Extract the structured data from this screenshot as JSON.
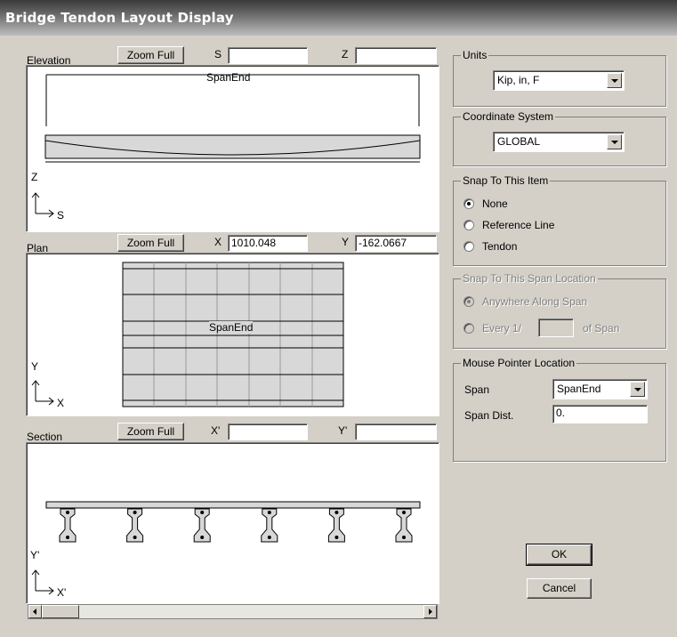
{
  "window": {
    "title": "Bridge Tendon Layout Display"
  },
  "elevation": {
    "label": "Elevation",
    "zoom_label": "Zoom Full",
    "coord1_label": "S",
    "coord1_value": "",
    "coord2_label": "Z",
    "coord2_value": "",
    "span_label": "SpanEnd",
    "axis_v": "Z",
    "axis_h": "S"
  },
  "plan": {
    "label": "Plan",
    "zoom_label": "Zoom Full",
    "coord1_label": "X",
    "coord1_value": "1010.048",
    "coord2_label": "Y",
    "coord2_value": "-162.0667",
    "span_label": "SpanEnd",
    "axis_v": "Y",
    "axis_h": "X"
  },
  "section": {
    "label": "Section",
    "zoom_label": "Zoom Full",
    "coord1_label": "X'",
    "coord1_value": "",
    "coord2_label": "Y'",
    "coord2_value": "",
    "axis_v": "Y'",
    "axis_h": "X'",
    "girder_count": 6
  },
  "units": {
    "title": "Units",
    "selected": "Kip, in, F"
  },
  "coord_system": {
    "title": "Coordinate System",
    "selected": "GLOBAL"
  },
  "snap_item": {
    "title": "Snap To This Item",
    "options": [
      "None",
      "Reference Line",
      "Tendon"
    ],
    "selected": "None"
  },
  "snap_span": {
    "title": "Snap To This Span Location",
    "option_anywhere": "Anywhere Along Span",
    "option_every": "Every 1/",
    "every_value": "",
    "of_span": "of Span"
  },
  "mouse": {
    "title": "Mouse Pointer Location",
    "span_label": "Span",
    "span_value": "SpanEnd",
    "dist_label": "Span Dist.",
    "dist_value": "0."
  },
  "buttons": {
    "ok": "OK",
    "cancel": "Cancel"
  },
  "colors": {
    "accent": "#000080",
    "face": "#d4d0c8",
    "deck": "#d8d8d8"
  }
}
